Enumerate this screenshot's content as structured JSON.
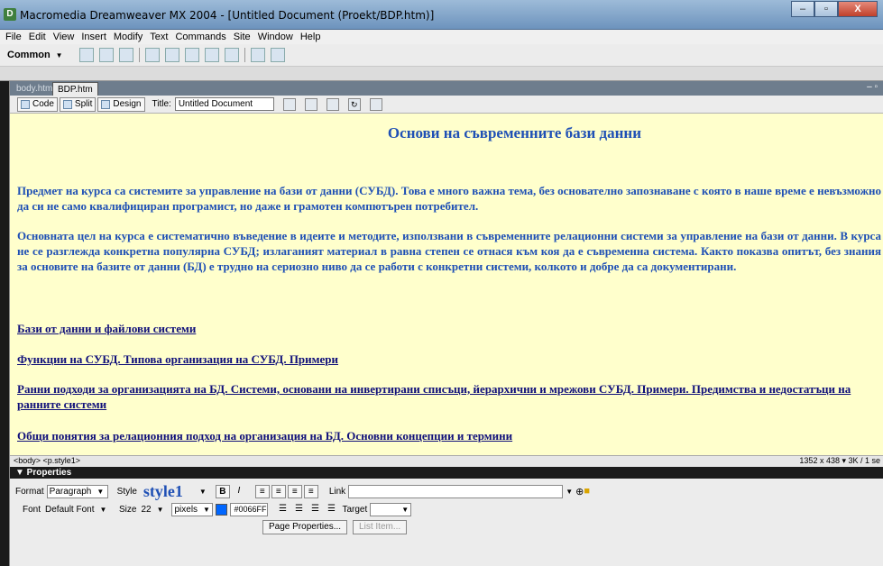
{
  "window": {
    "title": "Macromedia Dreamweaver MX 2004 - [Untitled Document (Proekt/BDP.htm)]",
    "minimize": "–",
    "maximize": "▫",
    "close": "X"
  },
  "menu": [
    "File",
    "Edit",
    "View",
    "Insert",
    "Modify",
    "Text",
    "Commands",
    "Site",
    "Window",
    "Help"
  ],
  "insert_toolbar": {
    "category": "Common"
  },
  "doc_tabs": {
    "inactive": "body.htm",
    "active": "BDP.htm"
  },
  "doc_toolbar": {
    "code": "Code",
    "split": "Split",
    "design": "Design",
    "title_label": "Title:",
    "title_value": "Untitled Document"
  },
  "content": {
    "heading": "Основи на съвременните бази данни",
    "paragraphs": [
      "Предмет на курса са системите за управление на бази от данни (СУБД). Това е много важна тема, без основателно запознаване с която в наше време е невъзможно да си не само квалифициран програмист, но даже и грамотен компютърен потребител.",
      "Основната цел на курса е систематично въведение в идеите и методите, използвани в съвременните релационни системи за управление на бази от данни. В курса не се разглежда конкретна популярна СУБД; излаганият материал в равна степен се отнася към коя да е съвременна система. Както показва опитът, без знания за основите на базите от данни (БД) е трудно на сериозно ниво да се работи с конкретни системи, колкото и добре да са документирани."
    ],
    "links": [
      "Бази от данни и файлови системи",
      "Функции на СУБД. Типова организация на СУБД. Примери",
      "Ранни подходи за организацията на БД. Системи, основани на инвертирани списъци, йерархични и мрежови СУБД. Примери. Предимства и недостатъци на ранните системи",
      "Общи понятия за релационния подход на организация на БД. Основни концепции и термини"
    ]
  },
  "status": {
    "tag_selector": "<body> <p.style1>",
    "size_info": "1352 x 438 ▾ 3K / 1 se"
  },
  "properties": {
    "header": "▼ Properties",
    "format_label": "Format",
    "format_value": "Paragraph",
    "style_label": "Style",
    "style_value": "style1",
    "bold": "B",
    "italic": "I",
    "link_label": "Link",
    "font_label": "Font",
    "font_value": "Default Font",
    "size_label": "Size",
    "size_value": "22",
    "unit_value": "pixels",
    "color_hex": "#0066FF",
    "target_label": "Target",
    "page_properties": "Page Properties...",
    "list_item": "List Item..."
  }
}
